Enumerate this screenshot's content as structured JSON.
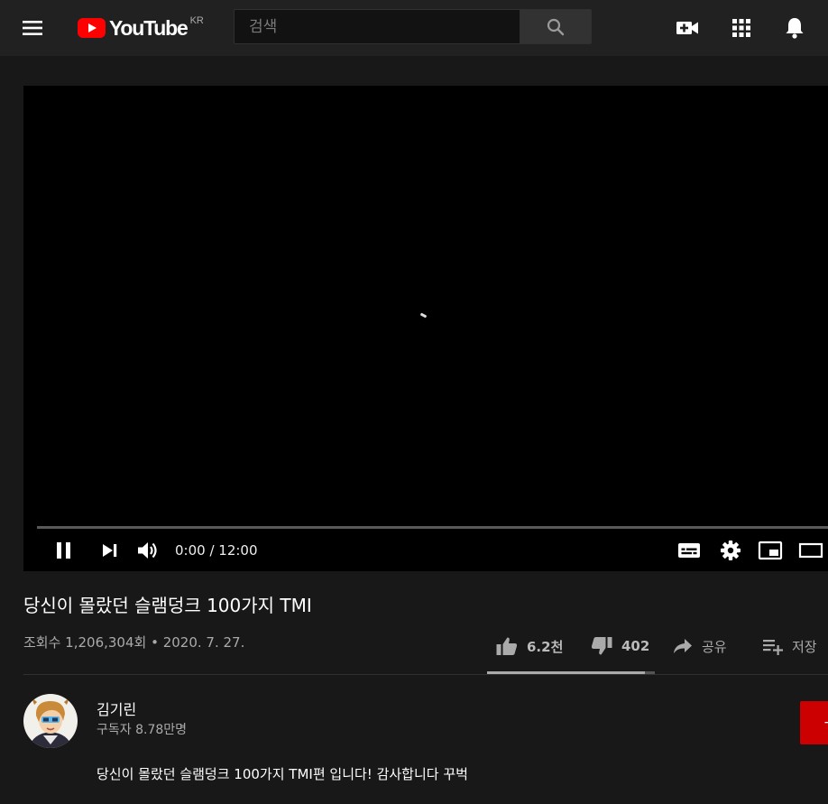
{
  "header": {
    "logo_text": "YouTube",
    "logo_region": "KR",
    "search_placeholder": "검색",
    "icons": [
      "menu-icon",
      "youtube-logo-icon",
      "search-icon",
      "create-video-icon",
      "apps-grid-icon",
      "notifications-bell-icon"
    ]
  },
  "player": {
    "time": "0:00 / 12:00",
    "progress": 0,
    "icons": [
      "pause-icon",
      "next-icon",
      "volume-icon",
      "subtitles-icon",
      "settings-gear-icon",
      "miniplayer-icon",
      "theater-mode-icon"
    ]
  },
  "video": {
    "title": "당신이 몰랐던 슬램덩크 100가지 TMI",
    "meta": "조회수 1,206,304회 • 2020. 7. 27.",
    "likes": "6.2천",
    "dislikes": "402",
    "share_label": "공유",
    "save_label": "저장",
    "like_ratio": 0.94
  },
  "channel": {
    "name": "김기린",
    "subscribers": "구독자 8.78만명",
    "description": "당신이 몰랐던 슬램덩크 100가지 TMI편 입니다! 감사합니다 꾸벅"
  },
  "colors": {
    "page_bg": "#181818",
    "header_bg": "#212121",
    "brand_red": "#ff0000",
    "subscribe_red": "#cc0000",
    "secondary_text": "#aaaaaa"
  }
}
